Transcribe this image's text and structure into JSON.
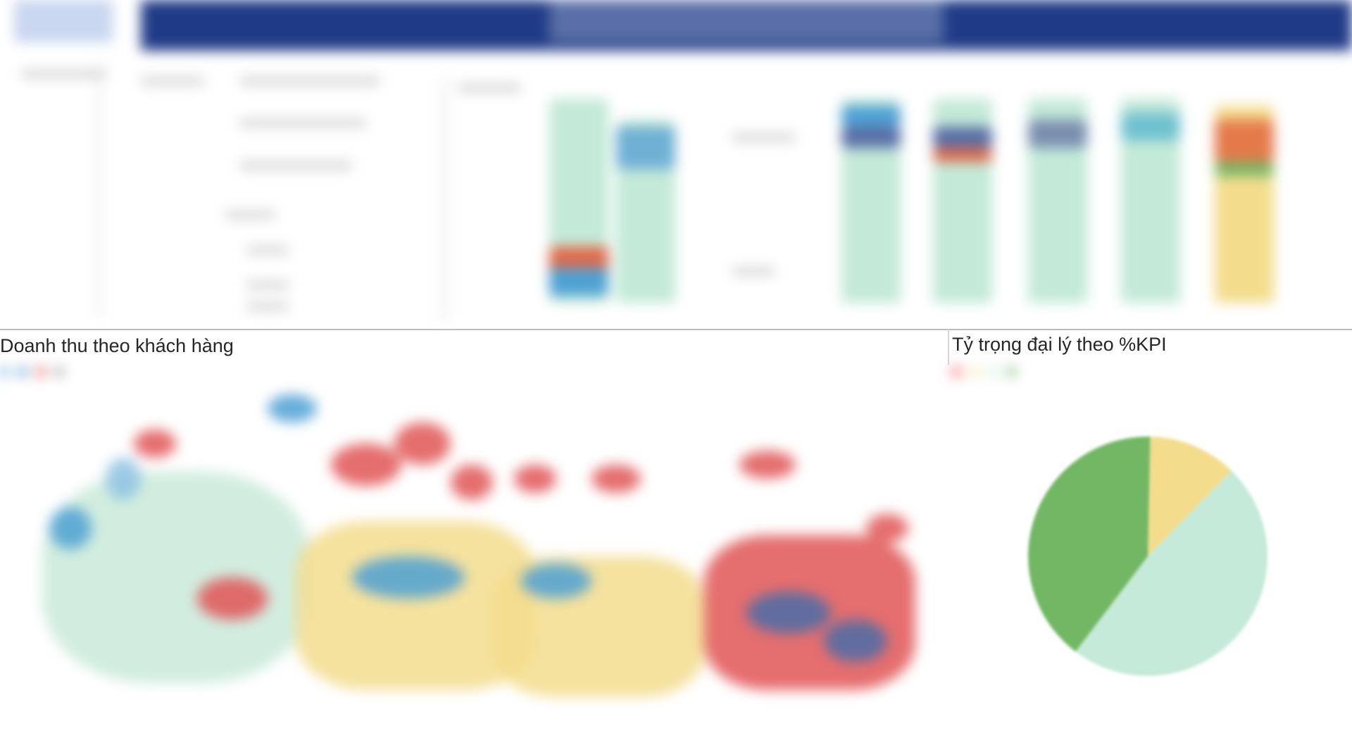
{
  "sections": {
    "customer_revenue_title": "Doanh thu theo khách hàng",
    "agent_kpi_title": "Tỷ trọng đại lý theo %KPI"
  },
  "colors": {
    "header_blue": "#203b86",
    "mint": "#bfe8d6",
    "yellow": "#f3dd8d",
    "red": "#e05555",
    "blue": "#4ea1d3",
    "green": "#72b864"
  },
  "customer_legend": [
    {
      "label": "",
      "color": "#4ea1d3"
    },
    {
      "label": "",
      "color": "#2f7fc1"
    },
    {
      "label": "",
      "color": "#e03a3a"
    },
    {
      "label": "",
      "color": "#8a8a8a"
    }
  ],
  "kpi_legend": [
    {
      "label": "",
      "color": "#e03a3a"
    },
    {
      "label": "",
      "color": "#f3dd8d"
    },
    {
      "label": "",
      "color": "#bfe8d6"
    },
    {
      "label": "",
      "color": "#5cae4f"
    }
  ],
  "chart_data": {
    "type": "pie",
    "title": "Tỷ trọng đại lý theo %KPI",
    "slices": [
      {
        "color": "#f3dd8d",
        "value": 12
      },
      {
        "color": "#c5ead9",
        "value": 48
      },
      {
        "color": "#72b864",
        "value": 40
      }
    ]
  }
}
